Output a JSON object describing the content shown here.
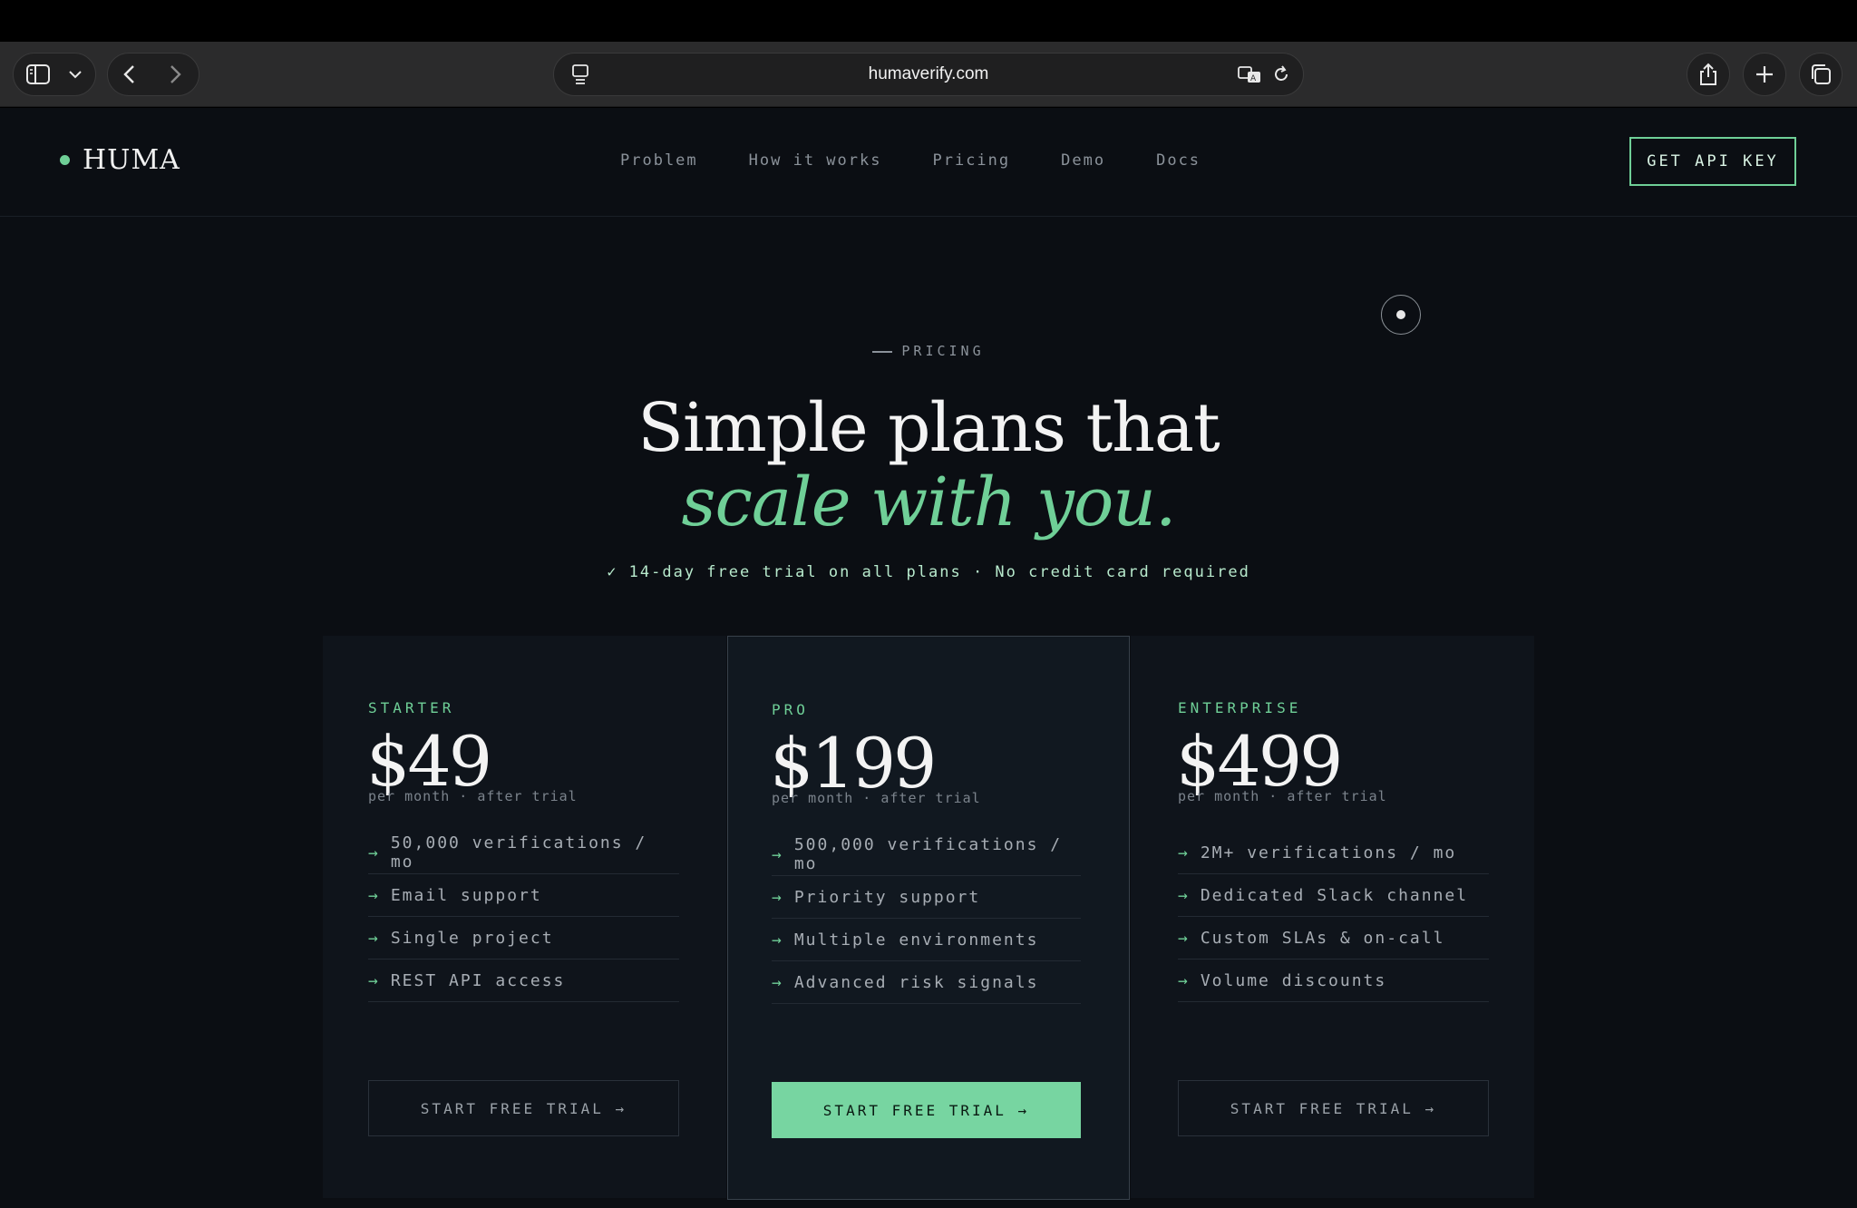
{
  "browser": {
    "url": "humaverify.com"
  },
  "nav": {
    "logo": "HUMA",
    "links": [
      "Problem",
      "How it works",
      "Pricing",
      "Demo",
      "Docs"
    ],
    "cta": "GET API KEY"
  },
  "hero": {
    "eyebrow": "PRICING",
    "title_line1": "Simple plans that",
    "title_line2": "scale with you.",
    "subline": "✓ 14-day free trial on all plans · No credit card required"
  },
  "plans": [
    {
      "tier": "STARTER",
      "price": "$49",
      "per": "per month · after trial",
      "features": [
        "50,000 verifications / mo",
        "Email support",
        "Single project",
        "REST API access"
      ],
      "button": "START FREE TRIAL →"
    },
    {
      "tier": "PRO",
      "price": "$199",
      "per": "per month · after trial",
      "features": [
        "500,000 verifications / mo",
        "Priority support",
        "Multiple environments",
        "Advanced risk signals"
      ],
      "button": "START FREE TRIAL →"
    },
    {
      "tier": "ENTERPRISE",
      "price": "$499",
      "per": "per month · after trial",
      "features": [
        "2M+ verifications / mo",
        "Dedicated Slack channel",
        "Custom SLAs & on-call",
        "Volume discounts"
      ],
      "button": "START FREE TRIAL →"
    }
  ],
  "colors": {
    "accent": "#6fcf97",
    "background": "#0b0e13",
    "card": "#0f141b"
  }
}
